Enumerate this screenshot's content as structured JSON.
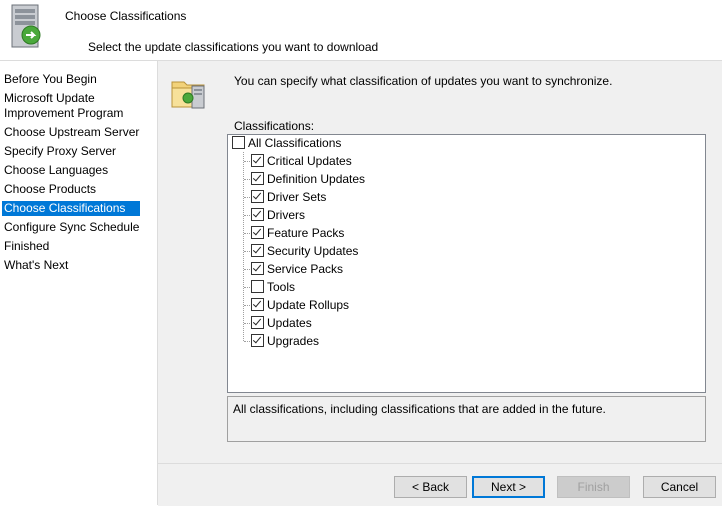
{
  "header": {
    "title": "Choose Classifications",
    "subtitle": "Select the update classifications you want to download",
    "icon": "server-sync-icon"
  },
  "nav": {
    "items": [
      {
        "label": "Before You Begin",
        "active": false
      },
      {
        "label": "Microsoft Update",
        "active": false
      },
      {
        "label": "Improvement Program",
        "active": false
      },
      {
        "label": "Choose Upstream Server",
        "active": false
      },
      {
        "label": "Specify Proxy Server",
        "active": false
      },
      {
        "label": "Choose Languages",
        "active": false
      },
      {
        "label": "Choose Products",
        "active": false
      },
      {
        "label": "Choose Classifications",
        "active": true
      },
      {
        "label": "Configure Sync Schedule",
        "active": false
      },
      {
        "label": "Finished",
        "active": false
      },
      {
        "label": "What's Next",
        "active": false
      }
    ]
  },
  "content": {
    "icon": "folder-server-icon",
    "intro": "You can specify what classification of updates you want to synchronize.",
    "classifications_label": "Classifications:",
    "root": {
      "label": "All Classifications",
      "checked": false
    },
    "items": [
      {
        "label": "Critical Updates",
        "checked": true
      },
      {
        "label": "Definition Updates",
        "checked": true
      },
      {
        "label": "Driver Sets",
        "checked": true
      },
      {
        "label": "Drivers",
        "checked": true
      },
      {
        "label": "Feature Packs",
        "checked": true
      },
      {
        "label": "Security Updates",
        "checked": true
      },
      {
        "label": "Service Packs",
        "checked": true
      },
      {
        "label": "Tools",
        "checked": false
      },
      {
        "label": "Update Rollups",
        "checked": true
      },
      {
        "label": "Updates",
        "checked": true
      },
      {
        "label": "Upgrades",
        "checked": true
      }
    ],
    "description": "All classifications, including classifications that are added in the future."
  },
  "buttons": {
    "back": "< Back",
    "next": "Next >",
    "finish": "Finish",
    "cancel": "Cancel"
  },
  "colors": {
    "accent": "#0078d7",
    "panel": "#f0f0f0"
  }
}
